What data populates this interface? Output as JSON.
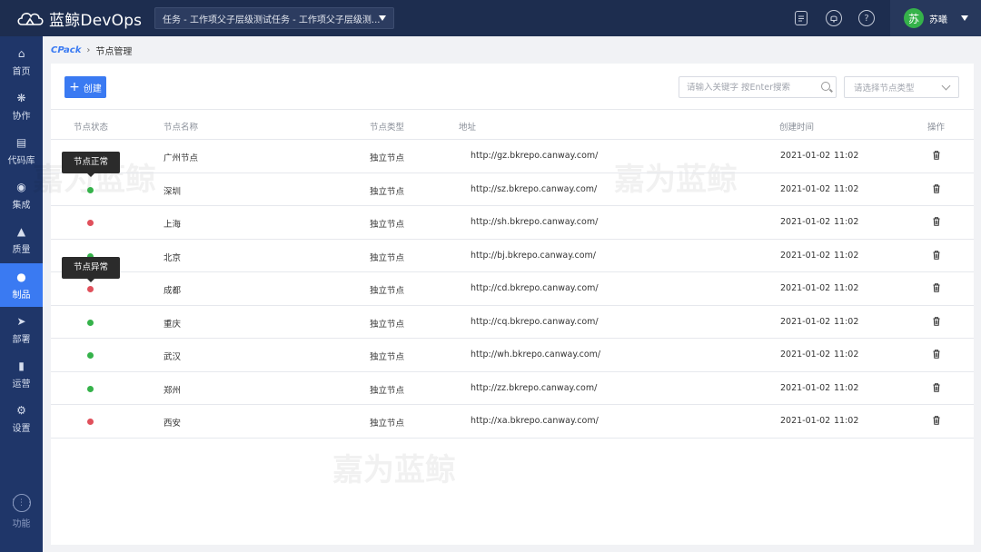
{
  "app": {
    "name": "蓝鲸DevOps",
    "project": "任务 - 工作项父子层级测试任务 - 工作项父子层级测..."
  },
  "user": {
    "avatar_text": "苏",
    "name": "苏曦"
  },
  "sidebar": {
    "items": [
      {
        "label": "首页",
        "icon": "home-icon"
      },
      {
        "label": "协作",
        "icon": "collab-icon"
      },
      {
        "label": "代码库",
        "icon": "code-icon"
      },
      {
        "label": "集成",
        "icon": "ci-icon"
      },
      {
        "label": "质量",
        "icon": "quality-icon"
      },
      {
        "label": "制品",
        "icon": "artifact-icon",
        "active": true
      },
      {
        "label": "部署",
        "icon": "deploy-icon"
      },
      {
        "label": "运营",
        "icon": "ops-icon"
      },
      {
        "label": "设置",
        "icon": "settings-icon"
      }
    ],
    "function_label": "功能"
  },
  "breadcrumb": {
    "root": "CPack",
    "current": "节点管理"
  },
  "toolbar": {
    "create_label": "创建",
    "search_placeholder": "请输入关键字 按Enter搜索",
    "type_placeholder": "请选择节点类型"
  },
  "table": {
    "headers": {
      "status": "节点状态",
      "name": "节点名称",
      "type": "节点类型",
      "address": "地址",
      "created": "创建时间",
      "action": "操作"
    },
    "rows": [
      {
        "status": "normal",
        "name": "广州节点",
        "type": "独立节点",
        "address": "http://gz.bkrepo.canway.com/",
        "date": "2021-01-02",
        "time": "11:02"
      },
      {
        "status": "normal",
        "name": "深圳",
        "type": "独立节点",
        "address": "http://sz.bkrepo.canway.com/",
        "date": "2021-01-02",
        "time": "11:02"
      },
      {
        "status": "abnormal",
        "name": "上海",
        "type": "独立节点",
        "address": "http://sh.bkrepo.canway.com/",
        "date": "2021-01-02",
        "time": "11:02"
      },
      {
        "status": "normal",
        "name": "北京",
        "type": "独立节点",
        "address": "http://bj.bkrepo.canway.com/",
        "date": "2021-01-02",
        "time": "11:02"
      },
      {
        "status": "abnormal",
        "name": "成都",
        "type": "独立节点",
        "address": "http://cd.bkrepo.canway.com/",
        "date": "2021-01-02",
        "time": "11:02"
      },
      {
        "status": "normal",
        "name": "重庆",
        "type": "独立节点",
        "address": "http://cq.bkrepo.canway.com/",
        "date": "2021-01-02",
        "time": "11:02"
      },
      {
        "status": "normal",
        "name": "武汉",
        "type": "独立节点",
        "address": "http://wh.bkrepo.canway.com/",
        "date": "2021-01-02",
        "time": "11:02"
      },
      {
        "status": "normal",
        "name": "郑州",
        "type": "独立节点",
        "address": "http://zz.bkrepo.canway.com/",
        "date": "2021-01-02",
        "time": "11:02"
      },
      {
        "status": "abnormal",
        "name": "西安",
        "type": "独立节点",
        "address": "http://xa.bkrepo.canway.com/",
        "date": "2021-01-02",
        "time": "11:02"
      }
    ]
  },
  "tooltips": {
    "normal": "节点正常",
    "abnormal": "节点异常"
  },
  "watermark_text": "嘉为蓝鲸",
  "colors": {
    "topbar": "#1d2d4f",
    "sidebar": "#1f3669",
    "accent": "#3a7af2",
    "status_normal": "#35b24a",
    "status_abnormal": "#e0505b"
  }
}
